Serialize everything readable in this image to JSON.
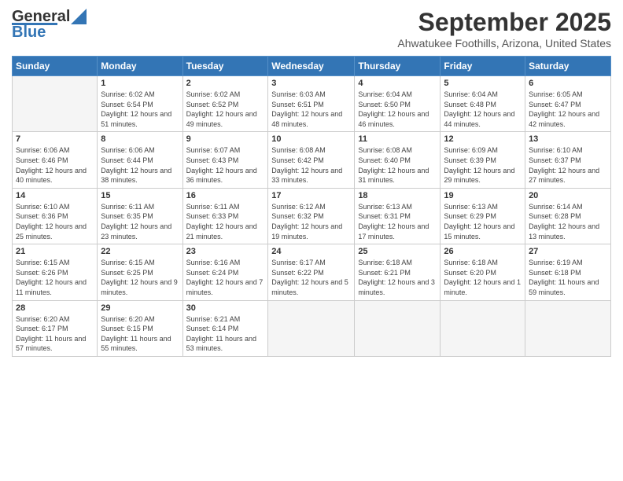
{
  "header": {
    "logo_line1": "General",
    "logo_line2": "Blue",
    "month": "September 2025",
    "location": "Ahwatukee Foothills, Arizona, United States"
  },
  "weekdays": [
    "Sunday",
    "Monday",
    "Tuesday",
    "Wednesday",
    "Thursday",
    "Friday",
    "Saturday"
  ],
  "weeks": [
    [
      {
        "day": "",
        "empty": true
      },
      {
        "day": "1",
        "sunrise": "6:02 AM",
        "sunset": "6:54 PM",
        "daylight": "12 hours and 51 minutes."
      },
      {
        "day": "2",
        "sunrise": "6:02 AM",
        "sunset": "6:52 PM",
        "daylight": "12 hours and 49 minutes."
      },
      {
        "day": "3",
        "sunrise": "6:03 AM",
        "sunset": "6:51 PM",
        "daylight": "12 hours and 48 minutes."
      },
      {
        "day": "4",
        "sunrise": "6:04 AM",
        "sunset": "6:50 PM",
        "daylight": "12 hours and 46 minutes."
      },
      {
        "day": "5",
        "sunrise": "6:04 AM",
        "sunset": "6:48 PM",
        "daylight": "12 hours and 44 minutes."
      },
      {
        "day": "6",
        "sunrise": "6:05 AM",
        "sunset": "6:47 PM",
        "daylight": "12 hours and 42 minutes."
      }
    ],
    [
      {
        "day": "7",
        "sunrise": "6:06 AM",
        "sunset": "6:46 PM",
        "daylight": "12 hours and 40 minutes."
      },
      {
        "day": "8",
        "sunrise": "6:06 AM",
        "sunset": "6:44 PM",
        "daylight": "12 hours and 38 minutes."
      },
      {
        "day": "9",
        "sunrise": "6:07 AM",
        "sunset": "6:43 PM",
        "daylight": "12 hours and 36 minutes."
      },
      {
        "day": "10",
        "sunrise": "6:08 AM",
        "sunset": "6:42 PM",
        "daylight": "12 hours and 33 minutes."
      },
      {
        "day": "11",
        "sunrise": "6:08 AM",
        "sunset": "6:40 PM",
        "daylight": "12 hours and 31 minutes."
      },
      {
        "day": "12",
        "sunrise": "6:09 AM",
        "sunset": "6:39 PM",
        "daylight": "12 hours and 29 minutes."
      },
      {
        "day": "13",
        "sunrise": "6:10 AM",
        "sunset": "6:37 PM",
        "daylight": "12 hours and 27 minutes."
      }
    ],
    [
      {
        "day": "14",
        "sunrise": "6:10 AM",
        "sunset": "6:36 PM",
        "daylight": "12 hours and 25 minutes."
      },
      {
        "day": "15",
        "sunrise": "6:11 AM",
        "sunset": "6:35 PM",
        "daylight": "12 hours and 23 minutes."
      },
      {
        "day": "16",
        "sunrise": "6:11 AM",
        "sunset": "6:33 PM",
        "daylight": "12 hours and 21 minutes."
      },
      {
        "day": "17",
        "sunrise": "6:12 AM",
        "sunset": "6:32 PM",
        "daylight": "12 hours and 19 minutes."
      },
      {
        "day": "18",
        "sunrise": "6:13 AM",
        "sunset": "6:31 PM",
        "daylight": "12 hours and 17 minutes."
      },
      {
        "day": "19",
        "sunrise": "6:13 AM",
        "sunset": "6:29 PM",
        "daylight": "12 hours and 15 minutes."
      },
      {
        "day": "20",
        "sunrise": "6:14 AM",
        "sunset": "6:28 PM",
        "daylight": "12 hours and 13 minutes."
      }
    ],
    [
      {
        "day": "21",
        "sunrise": "6:15 AM",
        "sunset": "6:26 PM",
        "daylight": "12 hours and 11 minutes."
      },
      {
        "day": "22",
        "sunrise": "6:15 AM",
        "sunset": "6:25 PM",
        "daylight": "12 hours and 9 minutes."
      },
      {
        "day": "23",
        "sunrise": "6:16 AM",
        "sunset": "6:24 PM",
        "daylight": "12 hours and 7 minutes."
      },
      {
        "day": "24",
        "sunrise": "6:17 AM",
        "sunset": "6:22 PM",
        "daylight": "12 hours and 5 minutes."
      },
      {
        "day": "25",
        "sunrise": "6:18 AM",
        "sunset": "6:21 PM",
        "daylight": "12 hours and 3 minutes."
      },
      {
        "day": "26",
        "sunrise": "6:18 AM",
        "sunset": "6:20 PM",
        "daylight": "12 hours and 1 minute."
      },
      {
        "day": "27",
        "sunrise": "6:19 AM",
        "sunset": "6:18 PM",
        "daylight": "11 hours and 59 minutes."
      }
    ],
    [
      {
        "day": "28",
        "sunrise": "6:20 AM",
        "sunset": "6:17 PM",
        "daylight": "11 hours and 57 minutes."
      },
      {
        "day": "29",
        "sunrise": "6:20 AM",
        "sunset": "6:15 PM",
        "daylight": "11 hours and 55 minutes."
      },
      {
        "day": "30",
        "sunrise": "6:21 AM",
        "sunset": "6:14 PM",
        "daylight": "11 hours and 53 minutes."
      },
      {
        "day": "",
        "empty": true
      },
      {
        "day": "",
        "empty": true
      },
      {
        "day": "",
        "empty": true
      },
      {
        "day": "",
        "empty": true
      }
    ]
  ]
}
